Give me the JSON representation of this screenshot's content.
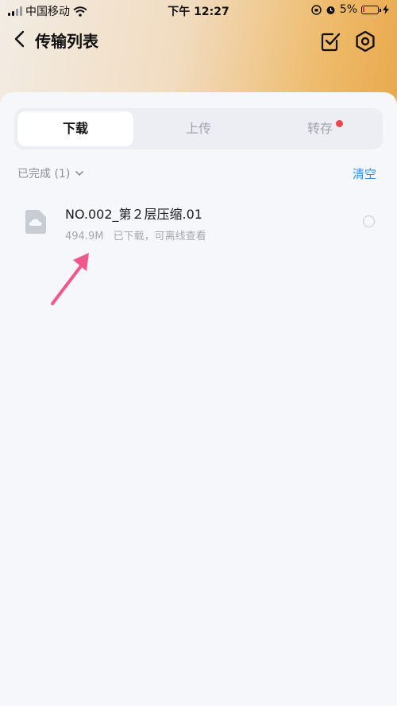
{
  "status_bar": {
    "carrier": "中国移动",
    "time": "下午 12:27",
    "battery": "5%"
  },
  "nav": {
    "title": "传输列表"
  },
  "tabs": [
    {
      "label": "下载",
      "active": true
    },
    {
      "label": "上传",
      "active": false
    },
    {
      "label": "转存",
      "active": false,
      "badge_dot": true
    }
  ],
  "section": {
    "label": "已完成 (1)",
    "action": "清空"
  },
  "files": [
    {
      "name": "NO.002_第２层压缩.01",
      "size": "494.9M",
      "status": "已下载，可离线查看"
    }
  ],
  "colors": {
    "accent": "#2d8cf0",
    "badge": "#f0454b",
    "annotation_arrow": "#f0578a"
  }
}
